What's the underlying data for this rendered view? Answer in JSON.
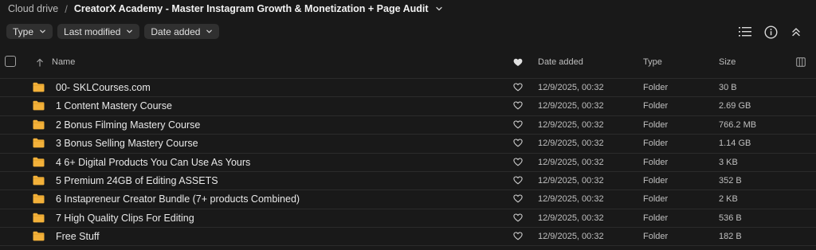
{
  "breadcrumb": {
    "root": "Cloud drive",
    "separator": "/",
    "current": "CreatorX Academy - Master Instagram Growth & Monetization + Page Audit"
  },
  "filters": [
    {
      "label": "Type"
    },
    {
      "label": "Last modified"
    },
    {
      "label": "Date added"
    }
  ],
  "toolbar": {
    "icons": [
      "list-view-icon",
      "info-icon",
      "collapse-icon"
    ]
  },
  "columns": {
    "name": "Name",
    "favourite_icon": "heart-filled-icon",
    "date_added": "Date added",
    "type": "Type",
    "size": "Size",
    "column_settings_icon": "columns-icon"
  },
  "rows": [
    {
      "name": "00- SKLCourses.com",
      "date": "12/9/2025, 00:32",
      "type": "Folder",
      "size": "30 B"
    },
    {
      "name": "1 Content Mastery Course",
      "date": "12/9/2025, 00:32",
      "type": "Folder",
      "size": "2.69 GB"
    },
    {
      "name": "2 Bonus Filming Mastery Course",
      "date": "12/9/2025, 00:32",
      "type": "Folder",
      "size": "766.2 MB"
    },
    {
      "name": "3 Bonus Selling Mastery Course",
      "date": "12/9/2025, 00:32",
      "type": "Folder",
      "size": "1.14 GB"
    },
    {
      "name": "4 6+ Digital Products You Can Use As Yours",
      "date": "12/9/2025, 00:32",
      "type": "Folder",
      "size": "3 KB"
    },
    {
      "name": "5 Premium 24GB of Editing ASSETS",
      "date": "12/9/2025, 00:32",
      "type": "Folder",
      "size": "352 B"
    },
    {
      "name": "6 Instapreneur Creator Bundle (7+ products Combined)",
      "date": "12/9/2025, 00:32",
      "type": "Folder",
      "size": "2 KB"
    },
    {
      "name": "7 High Quality Clips For Editing",
      "date": "12/9/2025, 00:32",
      "type": "Folder",
      "size": "536 B"
    },
    {
      "name": "Free Stuff",
      "date": "12/9/2025, 00:32",
      "type": "Folder",
      "size": "182 B"
    }
  ],
  "colors": {
    "background": "#191919",
    "folder": "#f3b13a",
    "chip": "#303030"
  }
}
